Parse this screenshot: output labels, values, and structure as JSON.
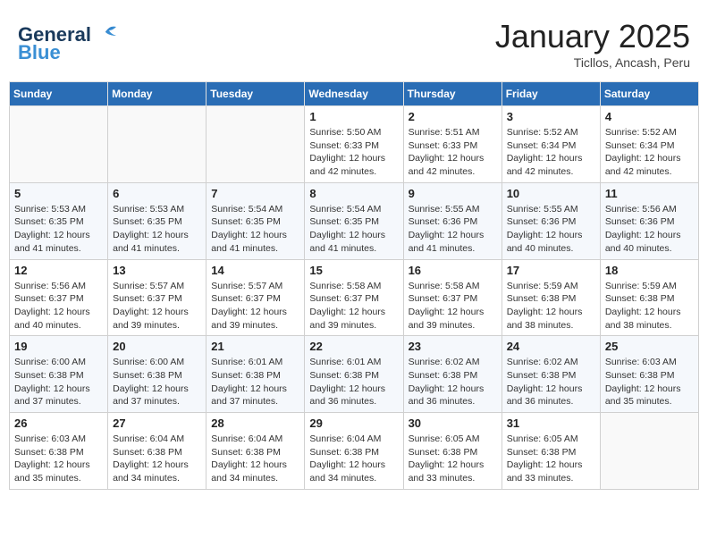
{
  "logo": {
    "line1": "General",
    "line2": "Blue"
  },
  "title": "January 2025",
  "subtitle": "Ticllos, Ancash, Peru",
  "weekdays": [
    "Sunday",
    "Monday",
    "Tuesday",
    "Wednesday",
    "Thursday",
    "Friday",
    "Saturday"
  ],
  "weeks": [
    [
      {
        "day": "",
        "info": ""
      },
      {
        "day": "",
        "info": ""
      },
      {
        "day": "",
        "info": ""
      },
      {
        "day": "1",
        "info": "Sunrise: 5:50 AM\nSunset: 6:33 PM\nDaylight: 12 hours\nand 42 minutes."
      },
      {
        "day": "2",
        "info": "Sunrise: 5:51 AM\nSunset: 6:33 PM\nDaylight: 12 hours\nand 42 minutes."
      },
      {
        "day": "3",
        "info": "Sunrise: 5:52 AM\nSunset: 6:34 PM\nDaylight: 12 hours\nand 42 minutes."
      },
      {
        "day": "4",
        "info": "Sunrise: 5:52 AM\nSunset: 6:34 PM\nDaylight: 12 hours\nand 42 minutes."
      }
    ],
    [
      {
        "day": "5",
        "info": "Sunrise: 5:53 AM\nSunset: 6:35 PM\nDaylight: 12 hours\nand 41 minutes."
      },
      {
        "day": "6",
        "info": "Sunrise: 5:53 AM\nSunset: 6:35 PM\nDaylight: 12 hours\nand 41 minutes."
      },
      {
        "day": "7",
        "info": "Sunrise: 5:54 AM\nSunset: 6:35 PM\nDaylight: 12 hours\nand 41 minutes."
      },
      {
        "day": "8",
        "info": "Sunrise: 5:54 AM\nSunset: 6:35 PM\nDaylight: 12 hours\nand 41 minutes."
      },
      {
        "day": "9",
        "info": "Sunrise: 5:55 AM\nSunset: 6:36 PM\nDaylight: 12 hours\nand 41 minutes."
      },
      {
        "day": "10",
        "info": "Sunrise: 5:55 AM\nSunset: 6:36 PM\nDaylight: 12 hours\nand 40 minutes."
      },
      {
        "day": "11",
        "info": "Sunrise: 5:56 AM\nSunset: 6:36 PM\nDaylight: 12 hours\nand 40 minutes."
      }
    ],
    [
      {
        "day": "12",
        "info": "Sunrise: 5:56 AM\nSunset: 6:37 PM\nDaylight: 12 hours\nand 40 minutes."
      },
      {
        "day": "13",
        "info": "Sunrise: 5:57 AM\nSunset: 6:37 PM\nDaylight: 12 hours\nand 39 minutes."
      },
      {
        "day": "14",
        "info": "Sunrise: 5:57 AM\nSunset: 6:37 PM\nDaylight: 12 hours\nand 39 minutes."
      },
      {
        "day": "15",
        "info": "Sunrise: 5:58 AM\nSunset: 6:37 PM\nDaylight: 12 hours\nand 39 minutes."
      },
      {
        "day": "16",
        "info": "Sunrise: 5:58 AM\nSunset: 6:37 PM\nDaylight: 12 hours\nand 39 minutes."
      },
      {
        "day": "17",
        "info": "Sunrise: 5:59 AM\nSunset: 6:38 PM\nDaylight: 12 hours\nand 38 minutes."
      },
      {
        "day": "18",
        "info": "Sunrise: 5:59 AM\nSunset: 6:38 PM\nDaylight: 12 hours\nand 38 minutes."
      }
    ],
    [
      {
        "day": "19",
        "info": "Sunrise: 6:00 AM\nSunset: 6:38 PM\nDaylight: 12 hours\nand 37 minutes."
      },
      {
        "day": "20",
        "info": "Sunrise: 6:00 AM\nSunset: 6:38 PM\nDaylight: 12 hours\nand 37 minutes."
      },
      {
        "day": "21",
        "info": "Sunrise: 6:01 AM\nSunset: 6:38 PM\nDaylight: 12 hours\nand 37 minutes."
      },
      {
        "day": "22",
        "info": "Sunrise: 6:01 AM\nSunset: 6:38 PM\nDaylight: 12 hours\nand 36 minutes."
      },
      {
        "day": "23",
        "info": "Sunrise: 6:02 AM\nSunset: 6:38 PM\nDaylight: 12 hours\nand 36 minutes."
      },
      {
        "day": "24",
        "info": "Sunrise: 6:02 AM\nSunset: 6:38 PM\nDaylight: 12 hours\nand 36 minutes."
      },
      {
        "day": "25",
        "info": "Sunrise: 6:03 AM\nSunset: 6:38 PM\nDaylight: 12 hours\nand 35 minutes."
      }
    ],
    [
      {
        "day": "26",
        "info": "Sunrise: 6:03 AM\nSunset: 6:38 PM\nDaylight: 12 hours\nand 35 minutes."
      },
      {
        "day": "27",
        "info": "Sunrise: 6:04 AM\nSunset: 6:38 PM\nDaylight: 12 hours\nand 34 minutes."
      },
      {
        "day": "28",
        "info": "Sunrise: 6:04 AM\nSunset: 6:38 PM\nDaylight: 12 hours\nand 34 minutes."
      },
      {
        "day": "29",
        "info": "Sunrise: 6:04 AM\nSunset: 6:38 PM\nDaylight: 12 hours\nand 34 minutes."
      },
      {
        "day": "30",
        "info": "Sunrise: 6:05 AM\nSunset: 6:38 PM\nDaylight: 12 hours\nand 33 minutes."
      },
      {
        "day": "31",
        "info": "Sunrise: 6:05 AM\nSunset: 6:38 PM\nDaylight: 12 hours\nand 33 minutes."
      },
      {
        "day": "",
        "info": ""
      }
    ]
  ]
}
